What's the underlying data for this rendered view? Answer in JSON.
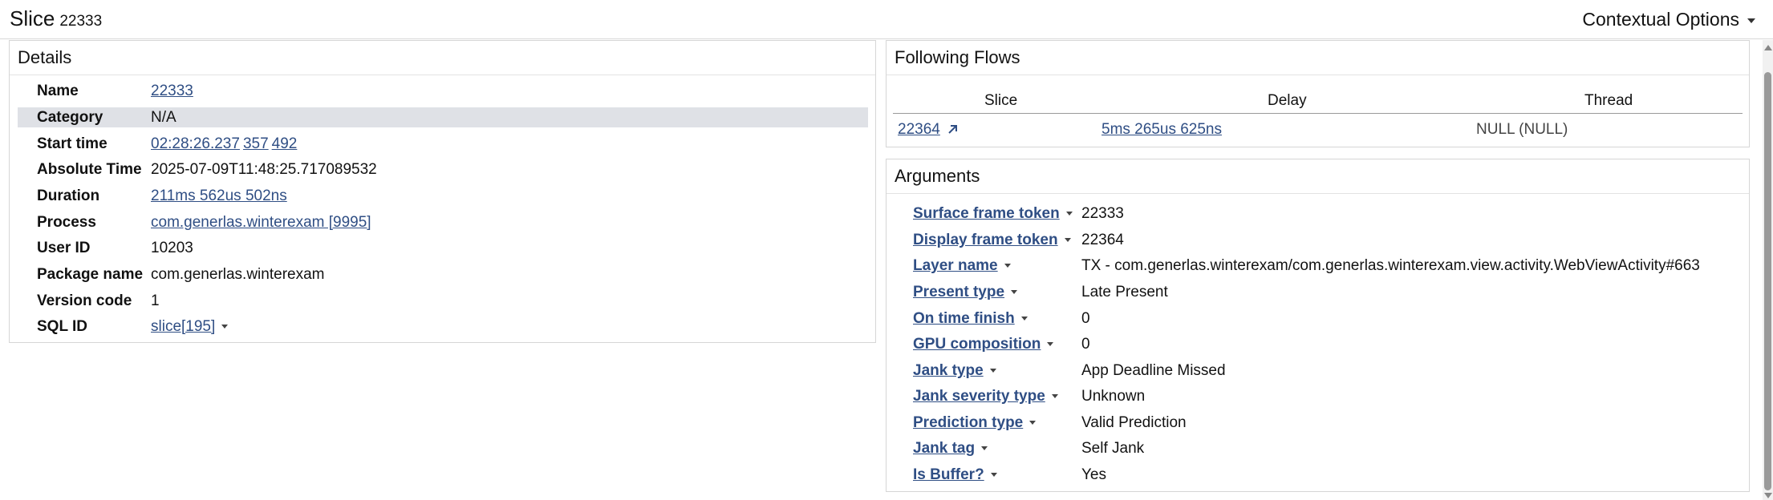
{
  "header": {
    "title": "Slice",
    "slice_id": "22333",
    "contextual_options": "Contextual Options"
  },
  "details": {
    "heading": "Details",
    "rows": [
      {
        "label": "Name",
        "value": "22333"
      },
      {
        "label": "Category",
        "value": "N/A"
      },
      {
        "label": "Start time",
        "value_parts": [
          "02:28:26.237",
          "357",
          "492"
        ]
      },
      {
        "label": "Absolute Time",
        "value": "2025-07-09T11:48:25.717089532"
      },
      {
        "label": "Duration",
        "value": "211ms 562us 502ns"
      },
      {
        "label": "Process",
        "value": "com.generlas.winterexam [9995]"
      },
      {
        "label": "User ID",
        "value": "10203"
      },
      {
        "label": "Package name",
        "value": "com.generlas.winterexam"
      },
      {
        "label": "Version code",
        "value": "1"
      },
      {
        "label": "SQL ID",
        "value": "slice[195]"
      }
    ]
  },
  "flows": {
    "heading": "Following Flows",
    "columns": [
      "Slice",
      "Delay",
      "Thread"
    ],
    "rows": [
      {
        "slice": "22364",
        "delay": "5ms 265us 625ns",
        "thread": "NULL (NULL)"
      }
    ]
  },
  "arguments": {
    "heading": "Arguments",
    "rows": [
      {
        "key": "Surface frame token",
        "value": "22333"
      },
      {
        "key": "Display frame token",
        "value": "22364"
      },
      {
        "key": "Layer name",
        "value": "TX - com.generlas.winterexam/com.generlas.winterexam.view.activity.WebViewActivity#663"
      },
      {
        "key": "Present type",
        "value": "Late Present"
      },
      {
        "key": "On time finish",
        "value": "0"
      },
      {
        "key": "GPU composition",
        "value": "0"
      },
      {
        "key": "Jank type",
        "value": "App Deadline Missed"
      },
      {
        "key": "Jank severity type",
        "value": "Unknown"
      },
      {
        "key": "Prediction type",
        "value": "Valid Prediction"
      },
      {
        "key": "Jank tag",
        "value": "Self Jank"
      },
      {
        "key": "Is Buffer?",
        "value": "Yes"
      }
    ]
  }
}
